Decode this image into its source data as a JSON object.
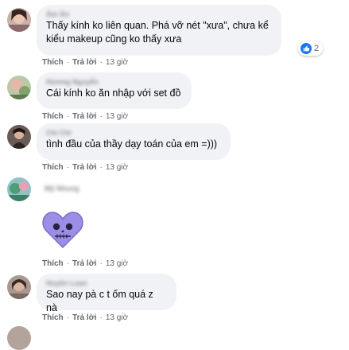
{
  "comments": [
    {
      "author": "Ám Ản",
      "text": "Thấy kính ko liên quan. Phá vỡ nét \"xưa\", chưa kể kiểu makeup cũng ko thấy xưa",
      "like_label": "Thích",
      "reply_label": "Trả lời",
      "time": "13 giờ",
      "reaction_count": "2"
    },
    {
      "author": "Hương Nguyễn",
      "text": "Cái kính ko ăn nhập với set đồ",
      "like_label": "Thích",
      "reply_label": "Trả lời",
      "time": "13 giờ"
    },
    {
      "author": "Chi Chi",
      "text": "tình đầu của thầy dạy toán của em =)))",
      "like_label": "Thích",
      "reply_label": "Trả lời",
      "time": "13 giờ"
    },
    {
      "author": "Mỹ Nhung",
      "sticker": "purple-heart-skull-sticker",
      "like_label": "Thích",
      "reply_label": "Trả lời",
      "time": "13 giờ"
    },
    {
      "author": "Huyền Loan",
      "text": "Sao nay pà c t ốm quá z nà",
      "like_label": "Thích",
      "reply_label": "Trả lời",
      "time": "13 giờ"
    }
  ],
  "colors": {
    "bubble": "#f0f2f5",
    "like_blue": "#1877f2",
    "meta_gray": "#65676b",
    "sticker_purple": "#9b8ee6"
  }
}
